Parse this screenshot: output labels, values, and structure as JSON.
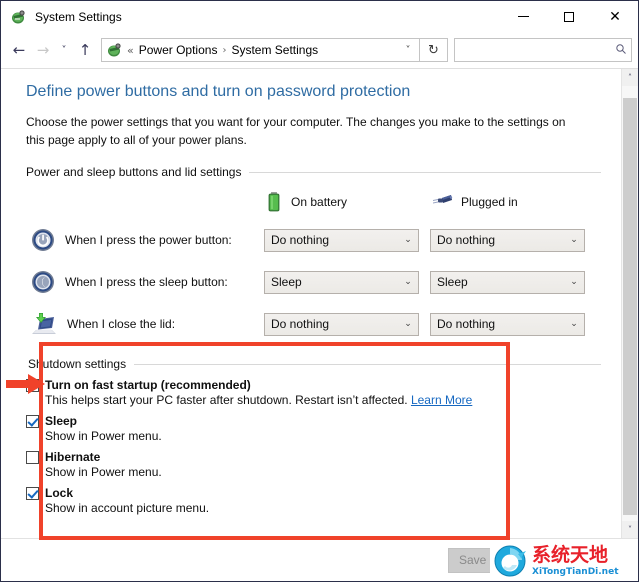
{
  "window": {
    "title": "System Settings",
    "title_icon": "power-options-icon",
    "controls": {
      "minimize": "—",
      "maximize": "□",
      "close": "✕"
    }
  },
  "navbar": {
    "back": "←",
    "forward": "→",
    "recent": "˅",
    "up": "↑",
    "breadcrumb": {
      "icon": "power-options-icon",
      "prefix": "«",
      "items": [
        "Power Options",
        "System Settings"
      ],
      "separator": "›",
      "dropdown": "˅"
    },
    "refresh": "↻",
    "search": {
      "value": "",
      "placeholder": "",
      "icon": "search-icon"
    }
  },
  "page": {
    "title": "Define power buttons and turn on password protection",
    "description": "Choose the power settings that you want for your computer. The changes you make to the settings on this page apply to all of your power plans.",
    "group_header": "Power and sleep buttons and lid settings"
  },
  "columns": [
    {
      "label": "On battery",
      "icon": "battery-icon"
    },
    {
      "label": "Plugged in",
      "icon": "power-plug-icon"
    }
  ],
  "settings_rows": [
    {
      "icon": "power-button-icon",
      "label": "When I press the power button:",
      "on_battery": "Do nothing",
      "plugged_in": "Do nothing"
    },
    {
      "icon": "sleep-button-icon",
      "label": "When I press the sleep button:",
      "on_battery": "Sleep",
      "plugged_in": "Sleep"
    },
    {
      "icon": "laptop-lid-icon",
      "label": "When I close the lid:",
      "on_battery": "Do nothing",
      "plugged_in": "Do nothing"
    }
  ],
  "shutdown": {
    "group_header": "Shutdown settings",
    "options": [
      {
        "label": "Turn on fast startup (recommended)",
        "checked": true,
        "description": "This helps start your PC faster after shutdown. Restart isn’t affected.",
        "link": "Learn More"
      },
      {
        "label": "Sleep",
        "checked": true,
        "description": "Show in Power menu.",
        "link": ""
      },
      {
        "label": "Hibernate",
        "checked": false,
        "description": "Show in Power menu.",
        "link": ""
      },
      {
        "label": "Lock",
        "checked": true,
        "description": "Show in account picture menu.",
        "link": ""
      }
    ]
  },
  "footer": {
    "save_label": "Save changes",
    "save_enabled": false
  },
  "scrollbar": {
    "up": "˄",
    "down": "˅"
  },
  "watermark": {
    "chinese": "系统天地",
    "english": "XiTongTianDi.net"
  },
  "annotation": {
    "box_color": "#f0422a",
    "arrow_color": "#f0422a"
  }
}
